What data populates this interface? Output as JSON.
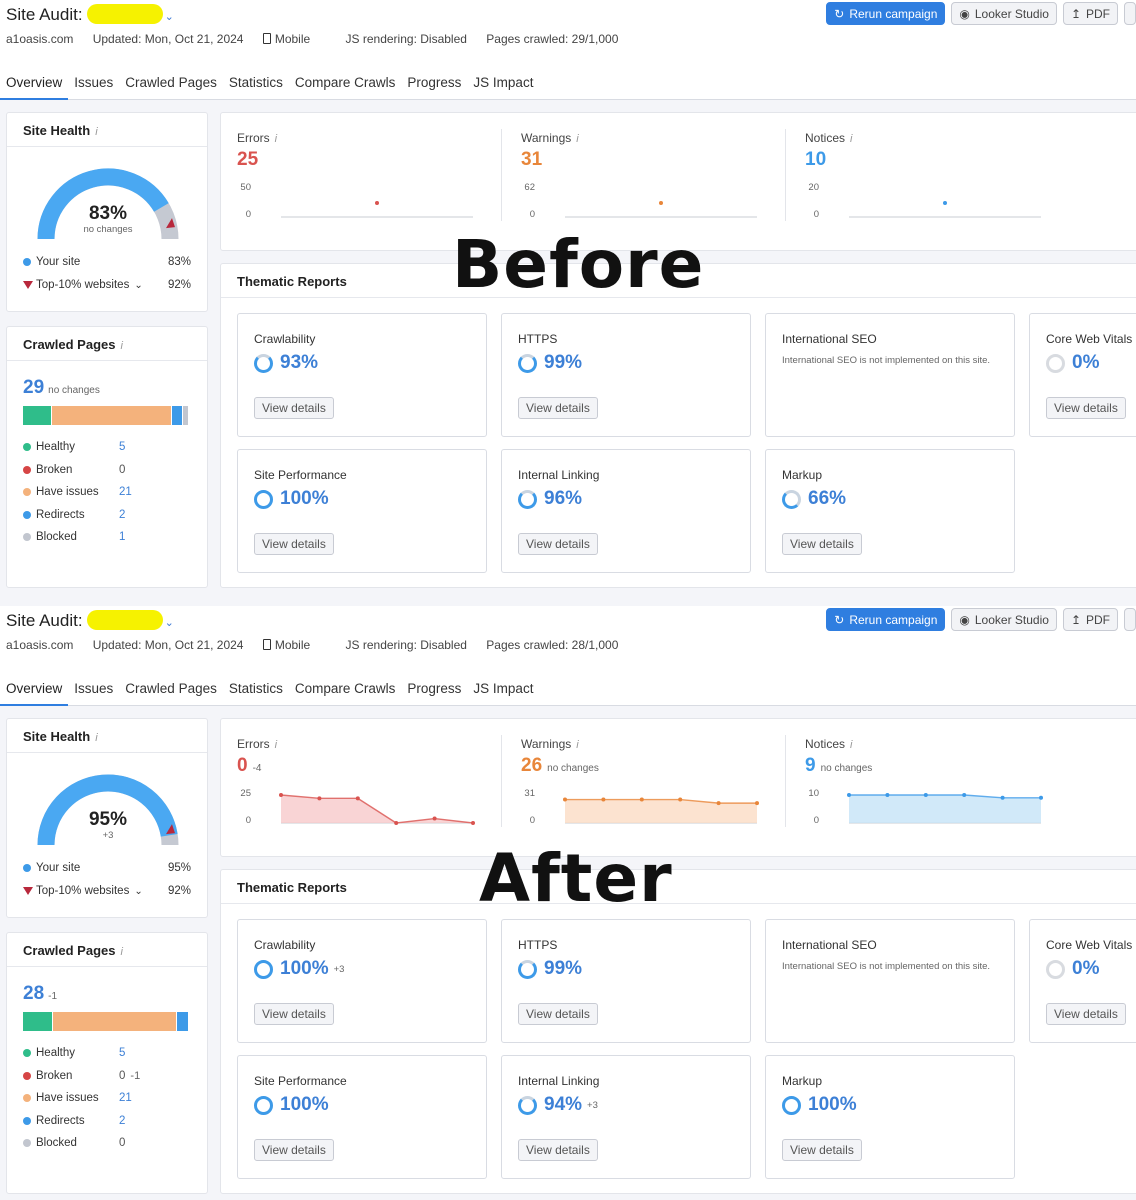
{
  "colors": {
    "accent": "#2f7ee0",
    "blue": "#3d80d6",
    "errors": "#d9534f",
    "warnings": "#e8863a",
    "notices": "#3d9ae8",
    "healthy": "#2fbd8a",
    "broken": "#d64545",
    "issues": "#f4b27c",
    "redirects": "#3d9ae8",
    "blocked": "#c2c6cf"
  },
  "overlay": {
    "before": "Before",
    "after": "After"
  },
  "before": {
    "title": "Site Audit:",
    "meta": {
      "domain": "a1oasis.com",
      "updated": "Updated: Mon, Oct 21, 2024",
      "device": "Mobile",
      "js": "JS rendering: Disabled",
      "pages": "Pages crawled: 29/1,000"
    },
    "buttons": {
      "rerun": "Rerun campaign",
      "looker": "Looker Studio",
      "pdf": "PDF"
    },
    "tabs": [
      "Overview",
      "Issues",
      "Crawled Pages",
      "Statistics",
      "Compare Crawls",
      "Progress",
      "JS Impact"
    ],
    "site_health": {
      "title": "Site Health",
      "value": 83,
      "value_text": "83%",
      "sub": "no changes",
      "your_site": "Your site",
      "your_site_pct": "83%",
      "top10": "Top-10% websites",
      "top10_pct": "92%",
      "top10_value": 92
    },
    "crawled": {
      "title": "Crawled Pages",
      "total": "29",
      "total_sub": "no changes",
      "counts": {
        "healthy": 5,
        "broken": 0,
        "issues": 21,
        "redirects": 2,
        "blocked": 1
      },
      "rows": [
        {
          "label": "Healthy",
          "value": "5",
          "delta": ""
        },
        {
          "label": "Broken",
          "value": "0",
          "delta": ""
        },
        {
          "label": "Have issues",
          "value": "21",
          "delta": ""
        },
        {
          "label": "Redirects",
          "value": "2",
          "delta": ""
        },
        {
          "label": "Blocked",
          "value": "1",
          "delta": ""
        }
      ]
    },
    "stats": [
      {
        "label": "Errors",
        "value": "25",
        "sub": "",
        "axis_top": "50",
        "axis_bottom": "0",
        "max": 50,
        "points": [
          25
        ]
      },
      {
        "label": "Warnings",
        "value": "31",
        "sub": "",
        "axis_top": "62",
        "axis_bottom": "0",
        "max": 62,
        "points": [
          31
        ]
      },
      {
        "label": "Notices",
        "value": "10",
        "sub": "",
        "axis_top": "20",
        "axis_bottom": "0",
        "max": 20,
        "points": [
          10
        ]
      }
    ],
    "thematic": {
      "title": "Thematic Reports",
      "view_label": "View details",
      "reports": [
        {
          "name": "Crawlability",
          "pct": "93%",
          "delta": ""
        },
        {
          "name": "HTTPS",
          "pct": "99%",
          "delta": ""
        },
        {
          "name": "International SEO",
          "desc": "International SEO is not implemented on this site."
        },
        {
          "name": "Core Web Vitals",
          "pct": "0%",
          "delta": ""
        },
        {
          "name": "Site Performance",
          "pct": "100%",
          "delta": ""
        },
        {
          "name": "Internal Linking",
          "pct": "96%",
          "delta": ""
        },
        {
          "name": "Markup",
          "pct": "66%",
          "delta": ""
        }
      ]
    }
  },
  "after": {
    "title": "Site Audit:",
    "meta": {
      "domain": "a1oasis.com",
      "updated": "Updated: Mon, Oct 21, 2024",
      "device": "Mobile",
      "js": "JS rendering: Disabled",
      "pages": "Pages crawled: 28/1,000"
    },
    "buttons": {
      "rerun": "Rerun campaign",
      "looker": "Looker Studio",
      "pdf": "PDF"
    },
    "tabs": [
      "Overview",
      "Issues",
      "Crawled Pages",
      "Statistics",
      "Compare Crawls",
      "Progress",
      "JS Impact"
    ],
    "site_health": {
      "title": "Site Health",
      "value": 95,
      "value_text": "95%",
      "sub": "+3",
      "your_site": "Your site",
      "your_site_pct": "95%",
      "top10": "Top-10% websites",
      "top10_pct": "92%",
      "top10_value": 92
    },
    "crawled": {
      "title": "Crawled Pages",
      "total": "28",
      "total_sub": "-1",
      "counts": {
        "healthy": 5,
        "broken": 0,
        "issues": 21,
        "redirects": 2,
        "blocked": 0
      },
      "rows": [
        {
          "label": "Healthy",
          "value": "5",
          "delta": ""
        },
        {
          "label": "Broken",
          "value": "0",
          "delta": "-1"
        },
        {
          "label": "Have issues",
          "value": "21",
          "delta": ""
        },
        {
          "label": "Redirects",
          "value": "2",
          "delta": ""
        },
        {
          "label": "Blocked",
          "value": "0",
          "delta": ""
        }
      ]
    },
    "stats": [
      {
        "label": "Errors",
        "value": "0",
        "sub": "-4",
        "axis_top": "25",
        "axis_bottom": "0",
        "max": 25,
        "points": [
          25,
          22,
          22,
          0,
          4,
          0
        ]
      },
      {
        "label": "Warnings",
        "value": "26",
        "sub": "no changes",
        "axis_top": "31",
        "axis_bottom": "0",
        "max": 31,
        "points": [
          26,
          26,
          26,
          26,
          22,
          22
        ]
      },
      {
        "label": "Notices",
        "value": "9",
        "sub": "no changes",
        "axis_top": "10",
        "axis_bottom": "0",
        "max": 10,
        "points": [
          10,
          10,
          10,
          10,
          9,
          9
        ]
      }
    ],
    "thematic": {
      "title": "Thematic Reports",
      "view_label": "View details",
      "reports": [
        {
          "name": "Crawlability",
          "pct": "100%",
          "delta": "+3"
        },
        {
          "name": "HTTPS",
          "pct": "99%",
          "delta": ""
        },
        {
          "name": "International SEO",
          "desc": "International SEO is not implemented on this site."
        },
        {
          "name": "Core Web Vitals",
          "pct": "0%",
          "delta": ""
        },
        {
          "name": "Site Performance",
          "pct": "100%",
          "delta": ""
        },
        {
          "name": "Internal Linking",
          "pct": "94%",
          "delta": "+3"
        },
        {
          "name": "Markup",
          "pct": "100%",
          "delta": ""
        }
      ]
    }
  }
}
